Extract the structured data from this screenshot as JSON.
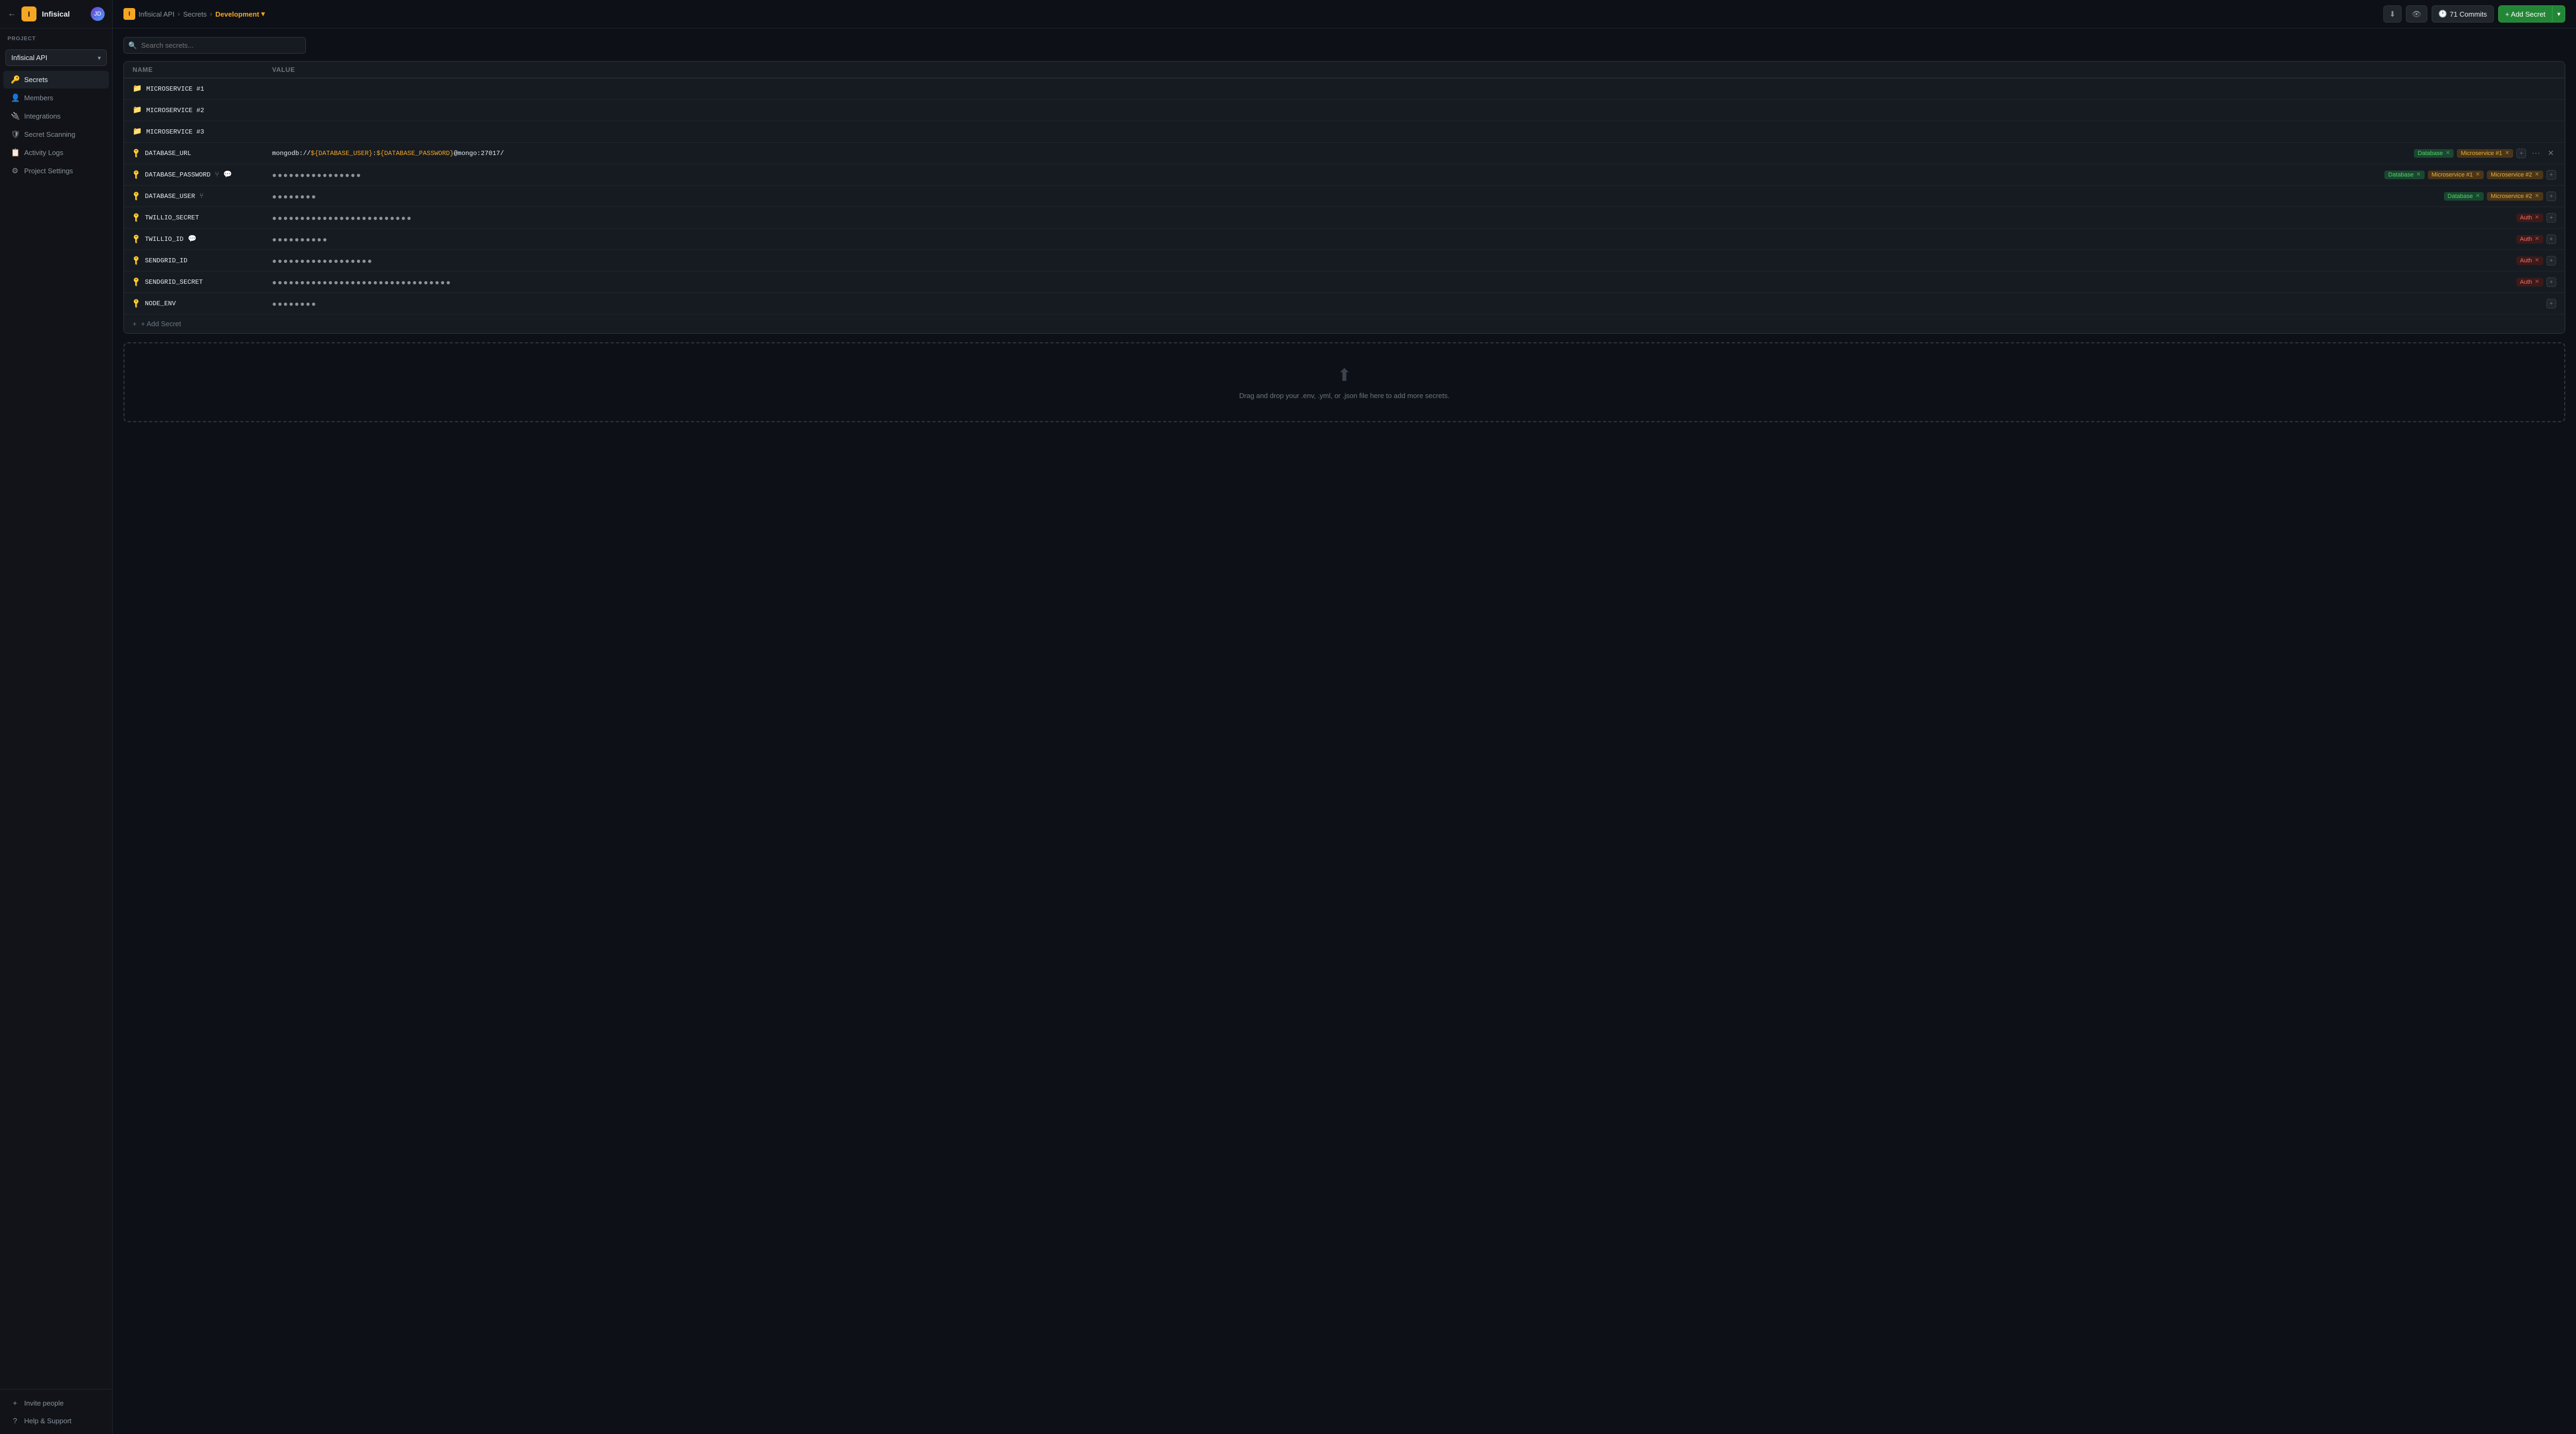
{
  "app": {
    "name": "Infisical",
    "logo_text": "I",
    "avatar_initials": "JD"
  },
  "sidebar": {
    "section_label": "PROJECT",
    "project_name": "Infisical API",
    "nav_items": [
      {
        "id": "secrets",
        "label": "Secrets",
        "icon": "🔑",
        "active": true
      },
      {
        "id": "members",
        "label": "Members",
        "icon": "👤",
        "active": false
      },
      {
        "id": "integrations",
        "label": "Integrations",
        "icon": "🔌",
        "active": false
      },
      {
        "id": "secret-scanning",
        "label": "Secret Scanning",
        "icon": "🛡",
        "active": false
      },
      {
        "id": "activity-logs",
        "label": "Activity Logs",
        "icon": "📋",
        "active": false
      },
      {
        "id": "project-settings",
        "label": "Project Settings",
        "icon": "⚙",
        "active": false
      }
    ],
    "bottom_items": [
      {
        "id": "invite-people",
        "label": "Invite people",
        "icon": "+"
      },
      {
        "id": "help-support",
        "label": "Help & Support",
        "icon": "?"
      }
    ]
  },
  "breadcrumb": {
    "logo_text": "I",
    "items": [
      {
        "label": "Infisical API"
      },
      {
        "label": "Secrets"
      },
      {
        "label": "Development",
        "current": true
      }
    ]
  },
  "toolbar": {
    "download_icon": "⬇",
    "eye_icon": "👁",
    "commits_label": "71 Commits",
    "add_secret_label": "+ Add Secret"
  },
  "search": {
    "placeholder": "Search secrets..."
  },
  "table": {
    "columns": [
      {
        "label": "Name"
      },
      {
        "label": "Value"
      }
    ],
    "rows": [
      {
        "type": "folder",
        "name": "MICROSERVICE #1",
        "value": "",
        "tags": [],
        "meta_icons": []
      },
      {
        "type": "folder",
        "name": "MICROSERVICE #2",
        "value": "",
        "tags": [],
        "meta_icons": []
      },
      {
        "type": "folder",
        "name": "MICROSERVICE #3",
        "value": "",
        "tags": [],
        "meta_icons": []
      },
      {
        "type": "secret",
        "name": "DATABASE_URL",
        "value": "mongodb://${DATABASE_USER}:${DATABASE_PASSWORD}@mongo:27017/",
        "value_visible": true,
        "tags": [
          {
            "label": "Database",
            "color": "green"
          },
          {
            "label": "Microservice #1",
            "color": "yellow"
          }
        ],
        "meta_icons": [],
        "show_more": true,
        "show_close": true
      },
      {
        "type": "secret",
        "name": "DATABASE_PASSWORD",
        "value": "••••••••••••••••",
        "value_visible": false,
        "dots": "●●●●●●●●●●●●●●●●",
        "tags": [
          {
            "label": "Database",
            "color": "green"
          },
          {
            "label": "Microservice #1",
            "color": "yellow"
          },
          {
            "label": "Microservice #2",
            "color": "yellow"
          }
        ],
        "meta_icons": [
          "fork",
          "comment"
        ]
      },
      {
        "type": "secret",
        "name": "DATABASE_USER",
        "value": "••••••••",
        "value_visible": false,
        "dots": "●●●●●●●●",
        "tags": [
          {
            "label": "Database",
            "color": "green"
          },
          {
            "label": "Microservice #2",
            "color": "yellow"
          }
        ],
        "meta_icons": [
          "fork"
        ]
      },
      {
        "type": "secret",
        "name": "TWILLIO_SECRET",
        "value": "•••••••••••••••••••••••••",
        "value_visible": false,
        "dots": "●●●●●●●●●●●●●●●●●●●●●●●●●",
        "tags": [
          {
            "label": "Auth",
            "color": "auth"
          }
        ],
        "meta_icons": []
      },
      {
        "type": "secret",
        "name": "TWILLIO_ID",
        "value": "••••••••••",
        "value_visible": false,
        "dots": "●●●●●●●●●●",
        "tags": [
          {
            "label": "Auth",
            "color": "auth"
          }
        ],
        "meta_icons": [
          "comment"
        ]
      },
      {
        "type": "secret",
        "name": "SENDGRID_ID",
        "value": "••••••••••••••••••",
        "value_visible": false,
        "dots": "●●●●●●●●●●●●●●●●●●",
        "tags": [
          {
            "label": "Auth",
            "color": "auth"
          }
        ],
        "meta_icons": []
      },
      {
        "type": "secret",
        "name": "SENDGRID_SECRET",
        "value": "••••••••••••••••••••••••••••••••",
        "value_visible": false,
        "dots": "●●●●●●●●●●●●●●●●●●●●●●●●●●●●●●●●",
        "tags": [
          {
            "label": "Auth",
            "color": "auth"
          }
        ],
        "meta_icons": []
      },
      {
        "type": "secret",
        "name": "NODE_ENV",
        "value": "••••••••",
        "value_visible": false,
        "dots": "●●●●●●●●",
        "tags": [],
        "meta_icons": []
      }
    ],
    "add_secret_label": "+ Add Secret"
  },
  "drag_drop": {
    "text": "Drag and drop your .env, .yml, or .json file here to add more secrets."
  }
}
